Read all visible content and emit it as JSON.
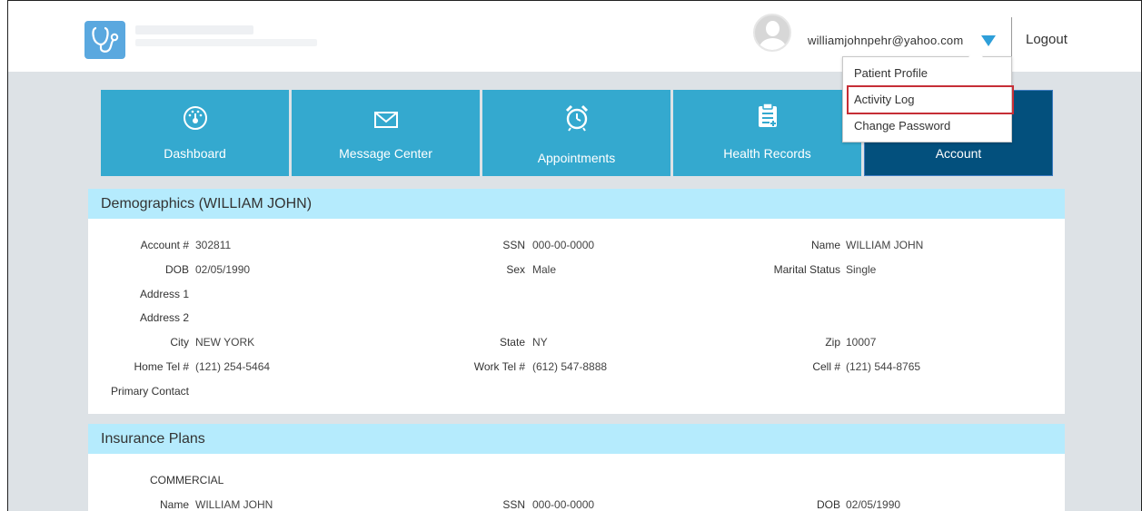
{
  "header": {
    "user_email": "williamjohnpehr@yahoo.com",
    "logout_label": "Logout"
  },
  "nav": {
    "tiles": [
      {
        "label": "Dashboard",
        "icon": "dashboard-gauge-icon"
      },
      {
        "label": "Message Center",
        "icon": "envelope-icon"
      },
      {
        "label": "Appointments",
        "icon": "alarm-clock-icon"
      },
      {
        "label": "Health Records",
        "icon": "clipboard-icon"
      },
      {
        "label": "Account",
        "icon": ""
      }
    ]
  },
  "dropdown": {
    "items": [
      "Patient Profile",
      "Activity Log",
      "Change Password"
    ],
    "highlighted": "Activity Log"
  },
  "demographics": {
    "title": "Demographics (WILLIAM JOHN)",
    "fields": {
      "account_label": "Account #",
      "account": "302811",
      "ssn_label": "SSN",
      "ssn": "000-00-0000",
      "name_label": "Name",
      "name": "WILLIAM JOHN",
      "dob_label": "DOB",
      "dob": "02/05/1990",
      "sex_label": "Sex",
      "sex": "Male",
      "marital_label": "Marital Status",
      "marital": "Single",
      "address1_label": "Address 1",
      "address2_label": "Address 2",
      "city_label": "City",
      "city": "NEW YORK",
      "state_label": "State",
      "state": "NY",
      "zip_label": "Zip",
      "zip": "10007",
      "home_tel_label": "Home Tel #",
      "home_tel": "(121) 254-5464",
      "work_tel_label": "Work Tel #",
      "work_tel": "(612) 547-8888",
      "cell_label": "Cell #",
      "cell": "(121) 544-8765",
      "primary_contact_label": "Primary Contact"
    }
  },
  "insurance": {
    "title": "Insurance Plans",
    "plan_type": "COMMERCIAL",
    "name_label": "Name",
    "name": "WILLIAM JOHN",
    "ssn_label": "SSN",
    "ssn": "000-00-0000",
    "dob_label": "DOB",
    "dob": "02/05/1990"
  },
  "colors": {
    "tile": "#34a9cf",
    "tile_active": "#03507d",
    "panel_header": "#b5ebfd",
    "highlight_border": "#c62e36",
    "caret": "#2e9fd9"
  }
}
